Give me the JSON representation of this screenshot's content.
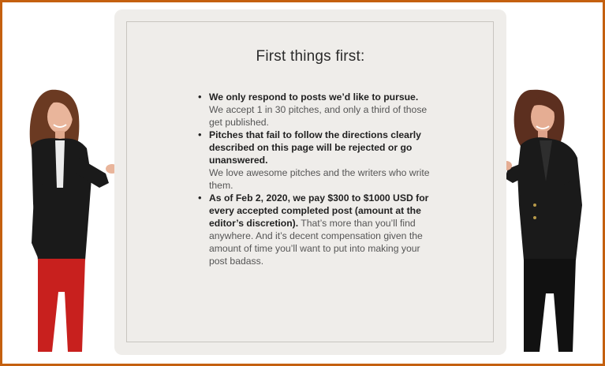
{
  "heading": "First things first:",
  "bullets": [
    {
      "bold": "We only respond to posts we’d like to pursue.",
      "normal": "We accept 1 in 30 pitches, and only a third of those get published."
    },
    {
      "bold": "Pitches that fail to follow the directions clearly described on this page will be rejected or go unanswered.",
      "normal": "We love awesome pitches and the writers who write them."
    },
    {
      "bold": "As of Feb 2, 2020, we pay $300 to $1000 USD for every accepted completed post (amount at the editor’s discretion).",
      "normal": " That’s more than you’ll find anywhere. And it’s decent compensation given the amount of time you’ll want to put into making your post badass."
    }
  ],
  "colors": {
    "frame_border": "#c4600f",
    "card_background": "#efedea",
    "jacket": "#1a1a1a",
    "pants_left": "#c8201e",
    "hair": "#6b3a22"
  }
}
